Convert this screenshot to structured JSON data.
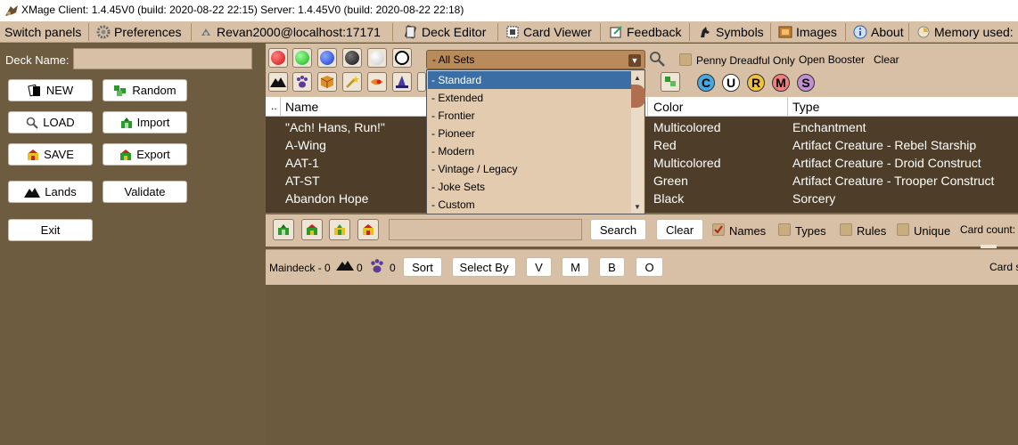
{
  "window": {
    "title": "XMage  Client: 1.4.45V0 (build: 2020-08-22 22:15)  Server: 1.4.45V0 (build: 2020-08-22 22:18)"
  },
  "menu": {
    "switch_panels": "Switch panels",
    "preferences": "Preferences",
    "server": "Revan2000@localhost:17171",
    "deck_editor": "Deck Editor",
    "card_viewer": "Card Viewer",
    "feedback": "Feedback",
    "symbols": "Symbols",
    "images": "Images",
    "about": "About",
    "memory": "Memory used:"
  },
  "left": {
    "deck_name_label": "Deck Name:",
    "deck_name_value": "",
    "buttons": {
      "new": "NEW",
      "random": "Random",
      "load": "LOAD",
      "import": "Import",
      "save": "SAVE",
      "export": "Export",
      "lands": "Lands",
      "validate": "Validate",
      "exit": "Exit"
    }
  },
  "filters": {
    "set_selected": "- All Sets",
    "penny_dreadful": "Penny Dreadful Only",
    "open_booster": "Open Booster",
    "clear": "Clear",
    "mana_symbols": [
      "C",
      "U",
      "R",
      "M",
      "S"
    ]
  },
  "dropdown": {
    "options": [
      "- Standard",
      "- Extended",
      "- Frontier",
      "- Pioneer",
      "- Modern",
      "- Vintage / Legacy",
      "- Joke Sets",
      "- Custom"
    ],
    "highlighted_index": 0
  },
  "table": {
    "columns": {
      "corner": "..",
      "name": "Name",
      "color": "Color",
      "type": "Type"
    },
    "rows": [
      {
        "name": "\"Ach! Hans, Run!\"",
        "color": "Multicolored",
        "type": "Enchantment"
      },
      {
        "name": "A-Wing",
        "color": "Red",
        "type": "Artifact Creature  - Rebel Starship"
      },
      {
        "name": "AAT-1",
        "color": "Multicolored",
        "type": "Artifact Creature  - Droid Construct"
      },
      {
        "name": "AT-ST",
        "color": "Green",
        "type": "Artifact Creature  - Trooper Construct"
      },
      {
        "name": "Abandon Hope",
        "color": "Black",
        "type": "Sorcery"
      }
    ]
  },
  "search": {
    "input_value": "",
    "search_button": "Search",
    "clear_button": "Clear",
    "names_label": "Names",
    "types_label": "Types",
    "rules_label": "Rules",
    "unique_label": "Unique",
    "card_count_label": "Card count:"
  },
  "maindeck": {
    "label": "Maindeck - 0",
    "lands_count": "0",
    "creatures_count": "0",
    "sort_button": "Sort",
    "select_by_button": "Select By",
    "v_button": "V",
    "m_button": "M",
    "b_button": "B",
    "o_button": "O",
    "card_label": "Card s"
  },
  "colors": {
    "accent_select": "#3a6ea5",
    "panel_tan": "#d7c0a6",
    "dark_brown": "#4e3e29"
  }
}
